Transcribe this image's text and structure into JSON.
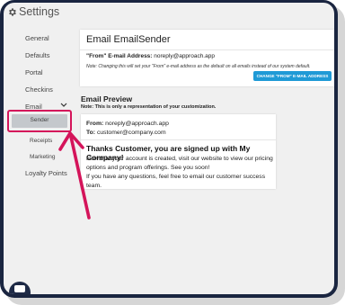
{
  "header": {
    "title": "Settings",
    "icon": "gear-icon"
  },
  "sidebar": {
    "items": [
      {
        "label": "General"
      },
      {
        "label": "Defaults"
      },
      {
        "label": "Portal"
      },
      {
        "label": "Checkins"
      },
      {
        "label": "Email"
      },
      {
        "label": "Loyalty Points"
      }
    ],
    "email_sub": [
      {
        "label": "Sender",
        "active": true
      },
      {
        "label": "Receipts"
      },
      {
        "label": "Marketing"
      }
    ]
  },
  "sender_card": {
    "title": "Email EmailSender",
    "from_label": "\"From\" E-mail Address:",
    "from_value": "noreply@approach.app",
    "note": "Note: Changing this will set your \"From\" e-mail address as the default on all emails instead of our system default.",
    "button": "CHANGE \"FROM\" E-MAIL ADDRESS"
  },
  "preview": {
    "title": "Email Preview",
    "note": "Note: This is only a representation of your customization.",
    "from_label": "From:",
    "from_value": "noreply@approach.app",
    "to_label": "To:",
    "to_value": "customer@company.com",
    "headline": "Thanks Customer, you are signed up with My Company!",
    "body": "Now that your account is created, visit our website to view our pricing options and program offerings. See you soon!",
    "body2": "If you have any questions, feel free to email our customer success team."
  },
  "colors": {
    "frame": "#1a2540",
    "highlight": "#d4145a",
    "button": "#1f9ad6",
    "active_bg": "#c4c8cc"
  }
}
